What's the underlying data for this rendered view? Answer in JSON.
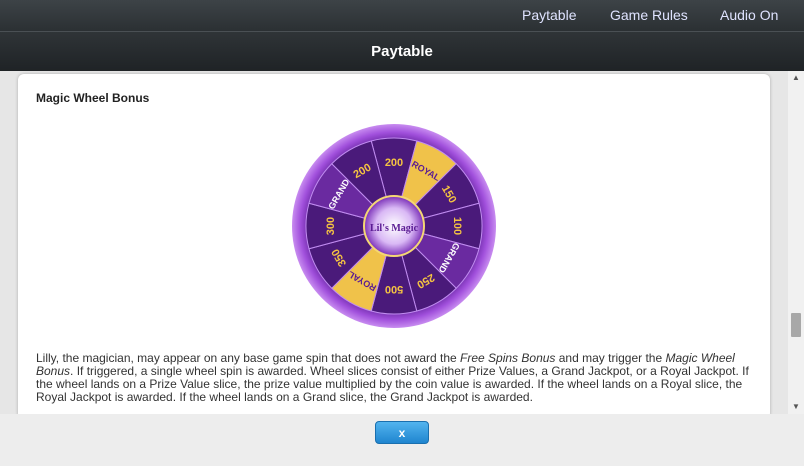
{
  "nav": {
    "paytable": "Paytable",
    "game_rules": "Game Rules",
    "audio": "Audio On"
  },
  "title": "Paytable",
  "section": {
    "title": "Magic Wheel Bonus",
    "wheel_logo": "Lil's Magic",
    "desc_part1": "Lilly, the magician, may appear on any base game spin that does not award the ",
    "desc_free_spins": "Free Spins Bonus",
    "desc_part2": " and may trigger the ",
    "desc_magic_wheel": "Magic Wheel Bonus",
    "desc_part3": ". If triggered, a single wheel spin is awarded. Wheel slices consist of either Prize Values, a Grand Jackpot, or a Royal Jackpot. If the wheel lands on a Prize Value slice, the prize value multiplied by the coin value is awarded. If the wheel lands on a Royal slice, the Royal Jackpot is awarded. If the wheel lands on a Grand slice, the Grand Jackpot is awarded."
  },
  "wheel": {
    "slices": [
      "200",
      "ROYAL",
      "150",
      "100",
      "GRAND",
      "250",
      "500",
      "ROYAL",
      "350",
      "300",
      "GRAND",
      "200"
    ],
    "colors": {
      "dark_slice": "#4a1a7a",
      "royal_slice": "#f0c24a",
      "rim": "#8c3ac8",
      "prize_text": "#f5c342"
    }
  },
  "close_button": "x"
}
